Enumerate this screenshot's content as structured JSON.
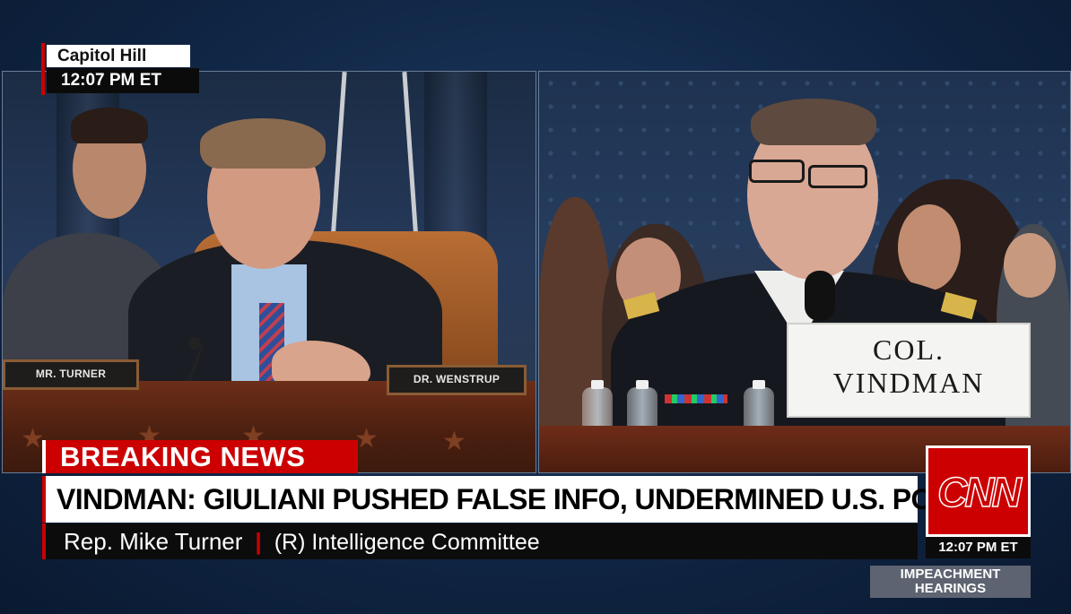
{
  "location": {
    "place": "Capitol Hill",
    "time": "12:07 PM ET"
  },
  "left_panel": {
    "nameplates": [
      "MR. TURNER",
      "DR. WENSTRUP"
    ]
  },
  "right_panel": {
    "placard_lines": [
      "COL.",
      "VINDMAN"
    ]
  },
  "lower_third": {
    "label": "BREAKING NEWS",
    "headline": "VINDMAN: GIULIANI PUSHED FALSE INFO, UNDERMINED U.S. POLICY",
    "speaker": "Rep. Mike Turner",
    "separator": "|",
    "affiliation": "(R) Intelligence Committee"
  },
  "network": {
    "logo": "CNN",
    "time": "12:07 PM ET"
  },
  "program_tag": {
    "line1": "IMPEACHMENT",
    "line2": "HEARINGS"
  },
  "colors": {
    "brand_red": "#cc0000",
    "background_navy": "#102645"
  }
}
